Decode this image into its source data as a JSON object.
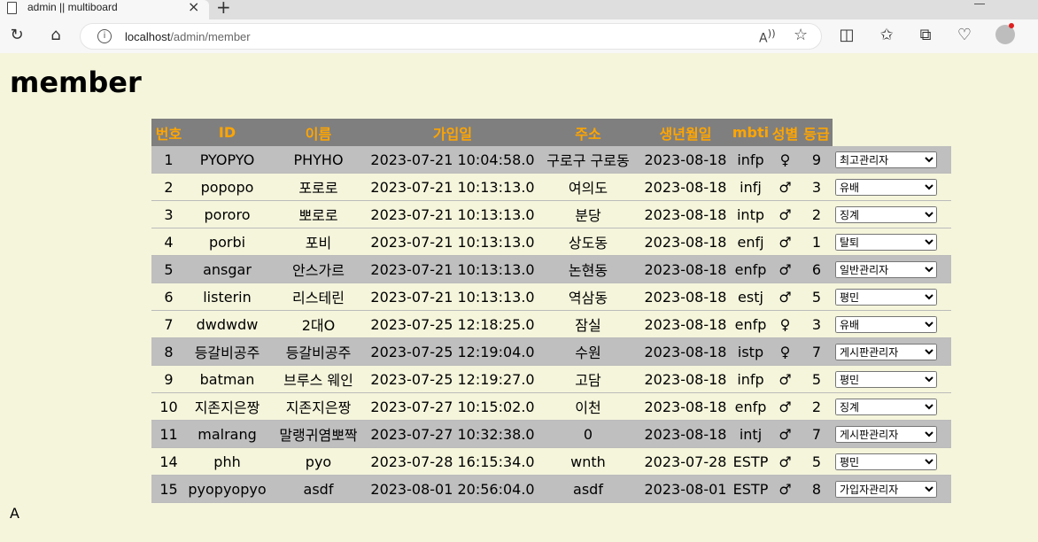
{
  "browser": {
    "tab_title": "admin || multiboard",
    "url_host": "localhost",
    "url_path": "/admin/member"
  },
  "page": {
    "title": "member",
    "footer": "A"
  },
  "table": {
    "headers": [
      "번호",
      "ID",
      "이름",
      "가입일",
      "주소",
      "생년월일",
      "mbti",
      "성별",
      "등급"
    ],
    "rows": [
      {
        "no": "1",
        "id": "PYOPYO",
        "name": "PHYHO",
        "joined": "2023-07-21 10:04:58.0",
        "address": "구로구 구로동",
        "birth": "2023-08-18",
        "mbti": "infp",
        "gender": "♀",
        "level": "9",
        "grade": "최고관리자",
        "highlight": true
      },
      {
        "no": "2",
        "id": "popopo",
        "name": "포로로",
        "joined": "2023-07-21 10:13:13.0",
        "address": "여의도",
        "birth": "2023-08-18",
        "mbti": "infj",
        "gender": "♂",
        "level": "3",
        "grade": "유배",
        "highlight": false
      },
      {
        "no": "3",
        "id": "pororo",
        "name": "뽀로로",
        "joined": "2023-07-21 10:13:13.0",
        "address": "분당",
        "birth": "2023-08-18",
        "mbti": "intp",
        "gender": "♂",
        "level": "2",
        "grade": "징계",
        "highlight": false
      },
      {
        "no": "4",
        "id": "porbi",
        "name": "포비",
        "joined": "2023-07-21 10:13:13.0",
        "address": "상도동",
        "birth": "2023-08-18",
        "mbti": "enfj",
        "gender": "♂",
        "level": "1",
        "grade": "탈퇴",
        "highlight": false
      },
      {
        "no": "5",
        "id": "ansgar",
        "name": "안스가르",
        "joined": "2023-07-21 10:13:13.0",
        "address": "논현동",
        "birth": "2023-08-18",
        "mbti": "enfp",
        "gender": "♂",
        "level": "6",
        "grade": "일반관리자",
        "highlight": true
      },
      {
        "no": "6",
        "id": "listerin",
        "name": "리스테린",
        "joined": "2023-07-21 10:13:13.0",
        "address": "역삼동",
        "birth": "2023-08-18",
        "mbti": "estj",
        "gender": "♂",
        "level": "5",
        "grade": "평민",
        "highlight": false
      },
      {
        "no": "7",
        "id": "dwdwdw",
        "name": "2대O",
        "joined": "2023-07-25 12:18:25.0",
        "address": "잠실",
        "birth": "2023-08-18",
        "mbti": "enfp",
        "gender": "♀",
        "level": "3",
        "grade": "유배",
        "highlight": false
      },
      {
        "no": "8",
        "id": "등갈비공주",
        "name": "등갈비공주",
        "joined": "2023-07-25 12:19:04.0",
        "address": "수원",
        "birth": "2023-08-18",
        "mbti": "istp",
        "gender": "♀",
        "level": "7",
        "grade": "게시판관리자",
        "highlight": true
      },
      {
        "no": "9",
        "id": "batman",
        "name": "브루스 웨인",
        "joined": "2023-07-25 12:19:27.0",
        "address": "고담",
        "birth": "2023-08-18",
        "mbti": "infp",
        "gender": "♂",
        "level": "5",
        "grade": "평민",
        "highlight": false
      },
      {
        "no": "10",
        "id": "지존지은짱",
        "name": "지존지은짱",
        "joined": "2023-07-27 10:15:02.0",
        "address": "이천",
        "birth": "2023-08-18",
        "mbti": "enfp",
        "gender": "♂",
        "level": "2",
        "grade": "징계",
        "highlight": false
      },
      {
        "no": "11",
        "id": "malrang",
        "name": "말랭귀염뽀짝",
        "joined": "2023-07-27 10:32:38.0",
        "address": "0",
        "birth": "2023-08-18",
        "mbti": "intj",
        "gender": "♂",
        "level": "7",
        "grade": "게시판관리자",
        "highlight": true
      },
      {
        "no": "14",
        "id": "phh",
        "name": "pyo",
        "joined": "2023-07-28 16:15:34.0",
        "address": "wnth",
        "birth": "2023-07-28",
        "mbti": "ESTP",
        "gender": "♂",
        "level": "5",
        "grade": "평민",
        "highlight": false
      },
      {
        "no": "15",
        "id": "pyopyopyo",
        "name": "asdf",
        "joined": "2023-08-01 20:56:04.0",
        "address": "asdf",
        "birth": "2023-08-01",
        "mbti": "ESTP",
        "gender": "♂",
        "level": "8",
        "grade": "가입자관리자",
        "highlight": true
      }
    ]
  }
}
